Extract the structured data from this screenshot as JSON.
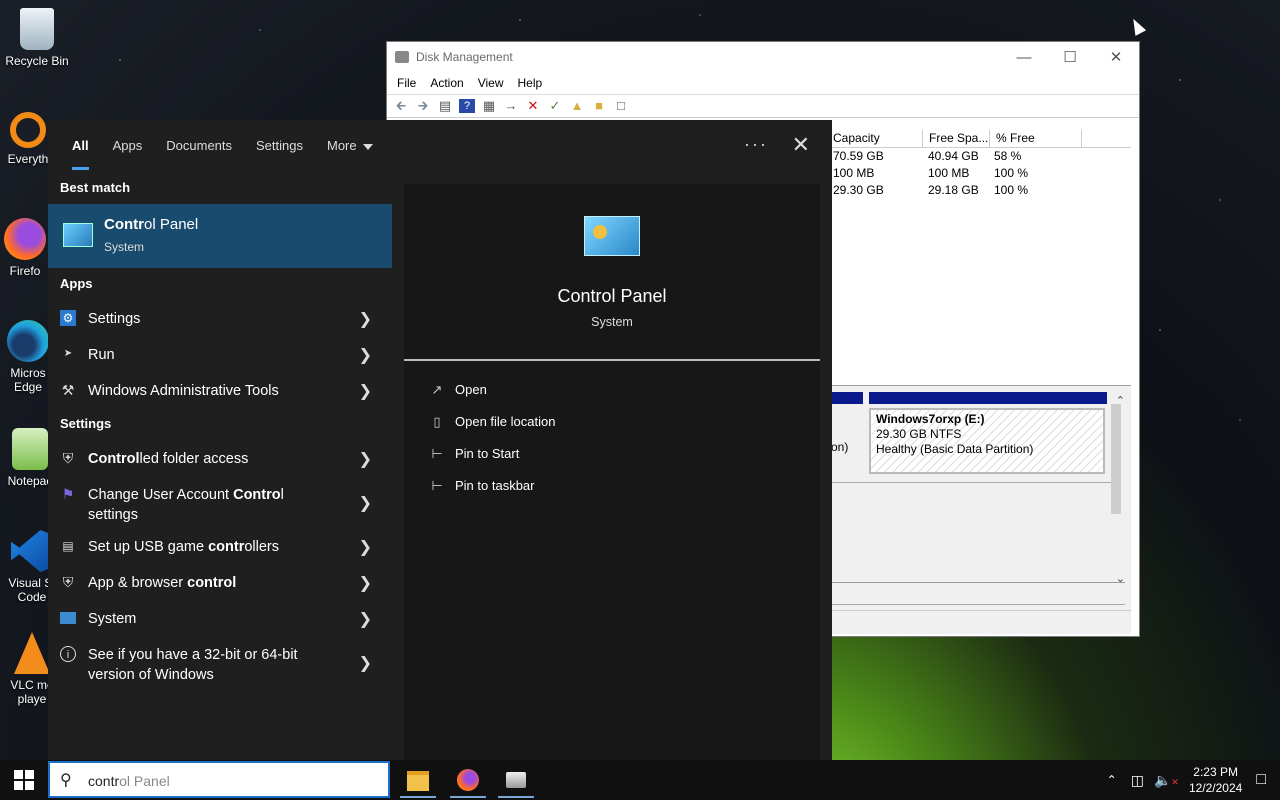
{
  "desktop": {
    "icons": [
      {
        "label": "Recycle Bin",
        "icon": "recycle-bin-icon"
      },
      {
        "label": "Everyth",
        "icon": "everything-search-icon"
      },
      {
        "label": "Firefo",
        "icon": "firefox-icon"
      },
      {
        "label": "Micros",
        "label2": "Edge",
        "icon": "edge-icon"
      },
      {
        "label": "Notepac",
        "icon": "notepad-icon"
      },
      {
        "label": "Visual St",
        "label2": "Code",
        "icon": "vscode-icon"
      },
      {
        "label": "VLC me",
        "label2": "playe",
        "icon": "vlc-icon"
      }
    ]
  },
  "disk_management": {
    "title": "Disk Management",
    "menu": [
      "File",
      "Action",
      "View",
      "Help"
    ],
    "columns": [
      "Capacity",
      "Free Spa...",
      "% Free"
    ],
    "rows": [
      [
        "70.59 GB",
        "40.94 GB",
        "58 %"
      ],
      [
        "100 MB",
        "100 MB",
        "100 %"
      ],
      [
        "29.30 GB",
        "29.18 GB",
        "100 %"
      ]
    ],
    "left_partition_fragment": "on)",
    "partition": {
      "name": "Windows7orxp  (E:)",
      "size": "29.30 GB NTFS",
      "status": "Healthy (Basic Data Partition)"
    }
  },
  "start_menu": {
    "tabs": [
      "All",
      "Apps",
      "Documents",
      "Settings",
      "More"
    ],
    "active_tab": "All",
    "best_match_header": "Best match",
    "best_match": {
      "title_bold": "Contr",
      "title_rest": "ol Panel",
      "subtitle": "System"
    },
    "apps_header": "Apps",
    "apps": [
      {
        "label": "Settings",
        "icon": "settings-gear-icon"
      },
      {
        "label": "Run",
        "icon": "run-icon"
      },
      {
        "label": "Windows Administrative Tools",
        "icon": "admin-tools-icon"
      }
    ],
    "settings_header": "Settings",
    "settings": [
      {
        "pre": "",
        "bold": "Control",
        "post": "led folder access",
        "icon": "shield-icon"
      },
      {
        "pre": "Change User Account ",
        "bold": "Contro",
        "post": "l",
        "line2": "settings",
        "icon": "uac-flag-icon"
      },
      {
        "pre": "Set up USB game ",
        "bold": "contr",
        "post": "ollers",
        "icon": "gamepad-icon"
      },
      {
        "pre": "App & browser ",
        "bold": "control",
        "post": "",
        "icon": "shield-icon"
      },
      {
        "pre": "System",
        "bold": "",
        "post": "",
        "icon": "monitor-icon"
      },
      {
        "pre": "See if you have a 32-bit or 64-bit",
        "bold": "",
        "post": "",
        "line2": "version of Windows",
        "icon": "info-icon"
      }
    ],
    "detail": {
      "title": "Control Panel",
      "subtitle": "System",
      "actions": [
        {
          "label": "Open",
          "icon": "open-icon"
        },
        {
          "label": "Open file location",
          "icon": "file-location-icon"
        },
        {
          "label": "Pin to Start",
          "icon": "pin-icon"
        },
        {
          "label": "Pin to taskbar",
          "icon": "pin-icon"
        }
      ]
    }
  },
  "taskbar": {
    "search_typed": "contr",
    "search_suggest": "ol Panel",
    "time": "2:23 PM",
    "date": "12/2/2024"
  }
}
